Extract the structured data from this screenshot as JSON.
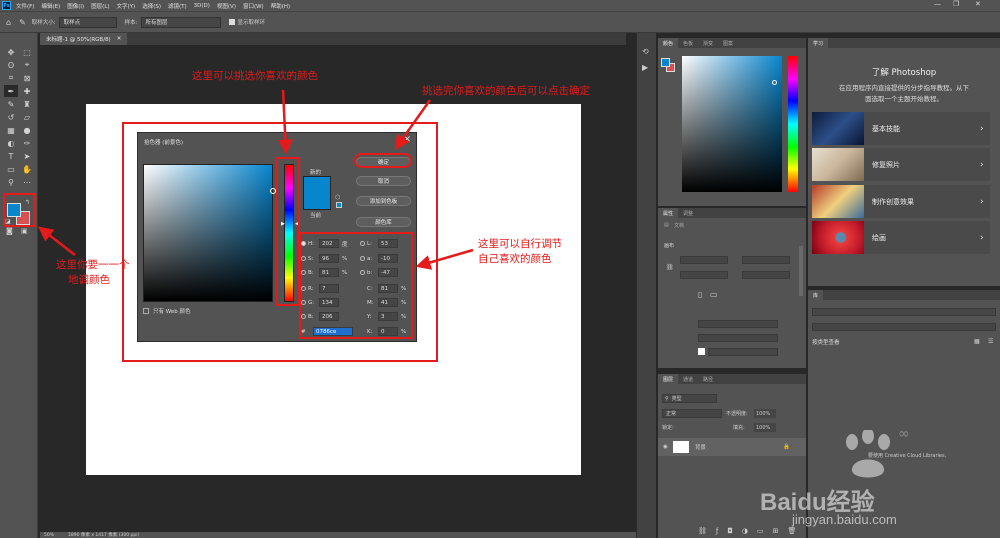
{
  "app": {
    "logo": "Ps",
    "menus": [
      "文件(F)",
      "编辑(E)",
      "图像(I)",
      "图层(L)",
      "文字(Y)",
      "选择(S)",
      "滤镜(T)",
      "3D(D)",
      "视图(V)",
      "窗口(W)",
      "帮助(H)"
    ],
    "window_controls": [
      "—",
      "❐",
      "✕"
    ]
  },
  "options_bar": {
    "sample_size_label": "取样大小:",
    "sample_size_value": "取样点",
    "sample_label": "样本:",
    "sample_value": "所有图层",
    "show_ring_label": "显示取样环"
  },
  "document": {
    "tab_label": "未标题-1 @ 50%(RGB/8)",
    "status_zoom": "50%",
    "status_info": "1890 像素 x 1417 像素 (300 ppi)"
  },
  "color_picker": {
    "title": "拾色器 (前景色)",
    "new_label": "新的",
    "current_label": "当前",
    "ok_label": "确定",
    "cancel_label": "取消",
    "add_swatch_label": "添加到色板",
    "color_library_label": "颜色库",
    "web_only_label": "只有 Web 颜色",
    "fields": {
      "H": "202",
      "S": "96",
      "B": "81",
      "R": "7",
      "G": "134",
      "B2": "206",
      "L": "53",
      "a": "-10",
      "b": "-47",
      "C": "81",
      "M": "41",
      "Y": "3",
      "K": "0"
    },
    "hex": "0786ce",
    "units": {
      "deg": "度",
      "pct": "%"
    },
    "new_color": "#0786ce",
    "current_color": "#0786ce"
  },
  "annotations": {
    "hue_strip": "这里可以挑选你喜欢的颜色",
    "ok_button": "挑选完你喜欢的颜色后可以点击确定",
    "fields": "这里可以自行调节自己喜欢的颜色",
    "fields_line1": "这里可以自行调节",
    "fields_line2": "自己喜欢的颜色",
    "foreground_line1": "这里你要一一个",
    "foreground_line2": "地调颜色",
    "color": "#e51a1a"
  },
  "panels": {
    "color_tabs": [
      "颜色",
      "色板",
      "渐变",
      "图案"
    ],
    "learn_tab": "学习",
    "learn_title": "了解 Photoshop",
    "learn_desc_line1": "在应用程序内直接提供的分步指导教程。从下",
    "learn_desc_line2": "面选取一个主题开始教程。",
    "learn_items": [
      "基本技能",
      "修复照片",
      "制作创意效果",
      "绘画"
    ],
    "properties_tabs": [
      "属性",
      "调整"
    ],
    "properties_doc": "文档",
    "canvas_section": "画布",
    "library_tab": "库",
    "library_view": "按类型查看",
    "layers_tabs": [
      "图层",
      "通道",
      "路径"
    ],
    "layers_search": "类型",
    "blend_mode": "正常",
    "opacity_label": "不透明度:",
    "opacity_value": "100%",
    "lock_label": "锁定:",
    "fill_label": "填充:",
    "fill_value": "100%",
    "layer_name": "背景",
    "cc_libraries": "要使用 Creative Cloud Libraries,"
  },
  "watermark": {
    "text": "Baidu经验",
    "url": "jingyan.baidu.com"
  }
}
